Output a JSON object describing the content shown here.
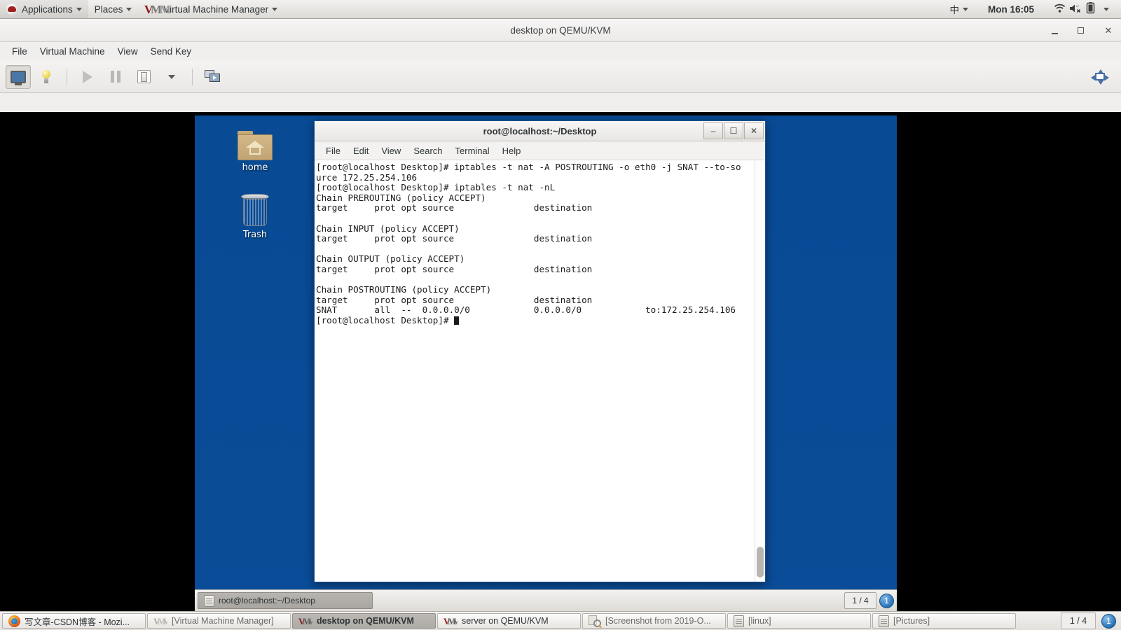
{
  "gnome_panel": {
    "applications_label": "Applications",
    "places_label": "Places",
    "window_menu_label": "Virtual Machine Manager",
    "ime_label": "中",
    "clock": "Mon 16:05"
  },
  "vmm_window": {
    "title": "desktop on QEMU/KVM",
    "menus": [
      "File",
      "Virtual Machine",
      "View",
      "Send Key"
    ]
  },
  "guest": {
    "desktop_icons": [
      {
        "name": "home",
        "icon": "folder-home-icon"
      },
      {
        "name": "Trash",
        "icon": "trash-icon"
      }
    ],
    "taskbar": {
      "items": [
        "root@localhost:~/Desktop"
      ],
      "workspace": "1 / 4",
      "badge": "1"
    }
  },
  "terminal": {
    "title": "root@localhost:~/Desktop",
    "menus": [
      "File",
      "Edit",
      "View",
      "Search",
      "Terminal",
      "Help"
    ],
    "lines": [
      "[root@localhost Desktop]# iptables -t nat -A POSTROUTING -o eth0 -j SNAT --to-so",
      "urce 172.25.254.106",
      "[root@localhost Desktop]# iptables -t nat -nL",
      "Chain PREROUTING (policy ACCEPT)",
      "target     prot opt source               destination",
      "",
      "Chain INPUT (policy ACCEPT)",
      "target     prot opt source               destination",
      "",
      "Chain OUTPUT (policy ACCEPT)",
      "target     prot opt source               destination",
      "",
      "Chain POSTROUTING (policy ACCEPT)",
      "target     prot opt source               destination",
      "SNAT       all  --  0.0.0.0/0            0.0.0.0/0            to:172.25.254.106"
    ],
    "prompt": "[root@localhost Desktop]# "
  },
  "host_taskbar": {
    "items": [
      {
        "label": "写文章-CSDN博客 - Mozi...",
        "icon": "firefox-icon",
        "state": "normal"
      },
      {
        "label": "[Virtual Machine Manager]",
        "icon": "vmm-icon",
        "state": "minimized"
      },
      {
        "label": "desktop on QEMU/KVM",
        "icon": "vmm-icon",
        "state": "active"
      },
      {
        "label": "server on QEMU/KVM",
        "icon": "vmm-icon",
        "state": "normal"
      },
      {
        "label": "[Screenshot from 2019-O...",
        "icon": "screenshot-icon",
        "state": "minimized"
      },
      {
        "label": "[linux]",
        "icon": "file-manager-icon",
        "state": "minimized"
      },
      {
        "label": "[Pictures]",
        "icon": "file-manager-icon",
        "state": "minimized"
      }
    ],
    "workspace": "1 / 4",
    "badge": "1"
  }
}
